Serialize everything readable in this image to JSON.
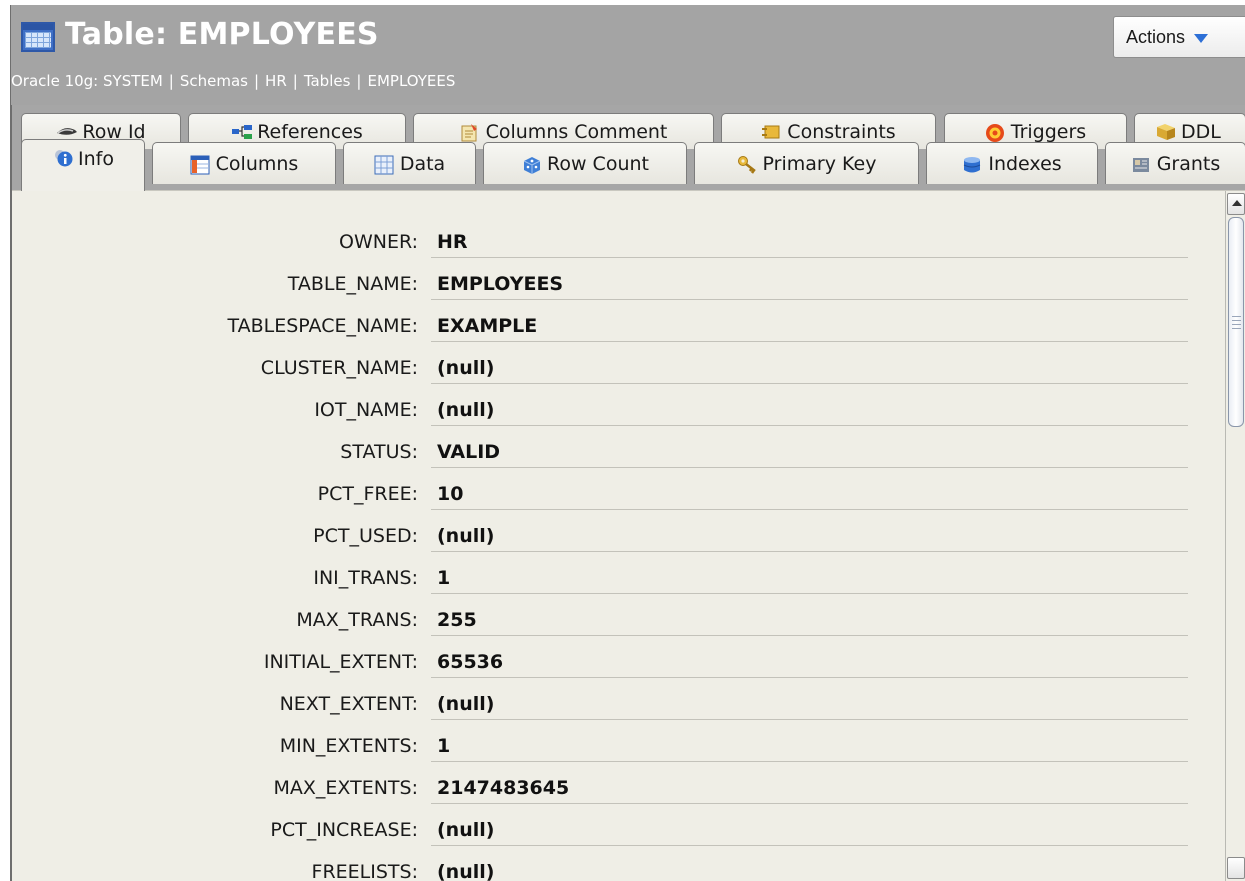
{
  "header": {
    "title": "Table: EMPLOYEES",
    "breadcrumb": [
      "Oracle 10g: SYSTEM",
      "Schemas",
      "HR",
      "Tables",
      "EMPLOYEES"
    ],
    "breadcrumb_separator": "|",
    "actions_label": "Actions",
    "header_bg": "#a4a4a4"
  },
  "tabs": {
    "row1": [
      {
        "label": "Row Id",
        "icon": "eye-icon"
      },
      {
        "label": "References",
        "icon": "references-icon"
      },
      {
        "label": "Columns Comment",
        "icon": "comment-icon"
      },
      {
        "label": "Constraints",
        "icon": "constraints-icon"
      },
      {
        "label": "Triggers",
        "icon": "target-icon"
      },
      {
        "label": "DDL",
        "icon": "ddl-icon"
      }
    ],
    "row2": [
      {
        "label": "Info",
        "icon": "info-icon",
        "active": true
      },
      {
        "label": "Columns",
        "icon": "columns-icon"
      },
      {
        "label": "Data",
        "icon": "grid-icon"
      },
      {
        "label": "Row Count",
        "icon": "dice-icon"
      },
      {
        "label": "Primary Key",
        "icon": "key-icon"
      },
      {
        "label": "Indexes",
        "icon": "cylinder-icon"
      },
      {
        "label": "Grants",
        "icon": "grants-icon"
      }
    ]
  },
  "properties": [
    {
      "label": "OWNER:",
      "value": "HR"
    },
    {
      "label": "TABLE_NAME:",
      "value": "EMPLOYEES"
    },
    {
      "label": "TABLESPACE_NAME:",
      "value": "EXAMPLE"
    },
    {
      "label": "CLUSTER_NAME:",
      "value": "(null)"
    },
    {
      "label": "IOT_NAME:",
      "value": "(null)"
    },
    {
      "label": "STATUS:",
      "value": "VALID"
    },
    {
      "label": "PCT_FREE:",
      "value": "10"
    },
    {
      "label": "PCT_USED:",
      "value": "(null)"
    },
    {
      "label": "INI_TRANS:",
      "value": "1"
    },
    {
      "label": "MAX_TRANS:",
      "value": "255"
    },
    {
      "label": "INITIAL_EXTENT:",
      "value": "65536"
    },
    {
      "label": "NEXT_EXTENT:",
      "value": "(null)"
    },
    {
      "label": "MIN_EXTENTS:",
      "value": "1"
    },
    {
      "label": "MAX_EXTENTS:",
      "value": "2147483645"
    },
    {
      "label": "PCT_INCREASE:",
      "value": "(null)"
    },
    {
      "label": "FREELISTS:",
      "value": "(null)"
    }
  ]
}
